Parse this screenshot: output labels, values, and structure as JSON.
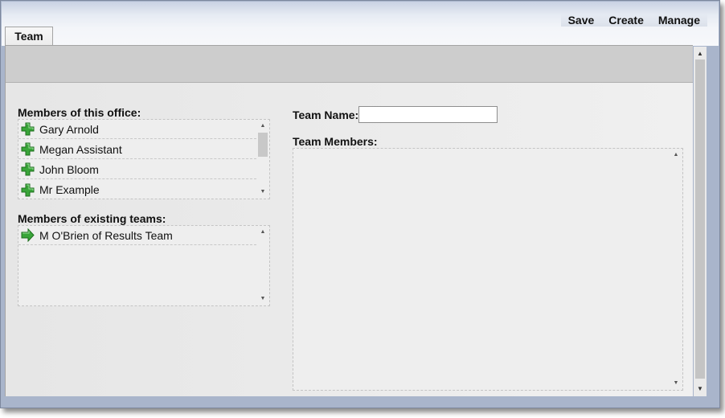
{
  "toolbar": {
    "actions": [
      "Save",
      "Create",
      "Manage"
    ]
  },
  "tabs": [
    {
      "label": "Team"
    }
  ],
  "office_members": {
    "label": "Members of this office:",
    "items": [
      "Gary Arnold",
      "Megan Assistant",
      "John Bloom",
      "Mr Example"
    ],
    "item_icon": "add-icon"
  },
  "existing_teams": {
    "label": "Members of existing teams:",
    "items": [
      "M O'Brien of Results Team"
    ],
    "item_icon": "arrow-right-icon"
  },
  "team": {
    "name_label": "Team Name:",
    "name_value": "",
    "members_label": "Team Members:",
    "members": []
  },
  "colors": {
    "add_icon": "#3aa53a",
    "arrow_icon": "#3aa53a",
    "window_border": "#a9b5cb"
  }
}
